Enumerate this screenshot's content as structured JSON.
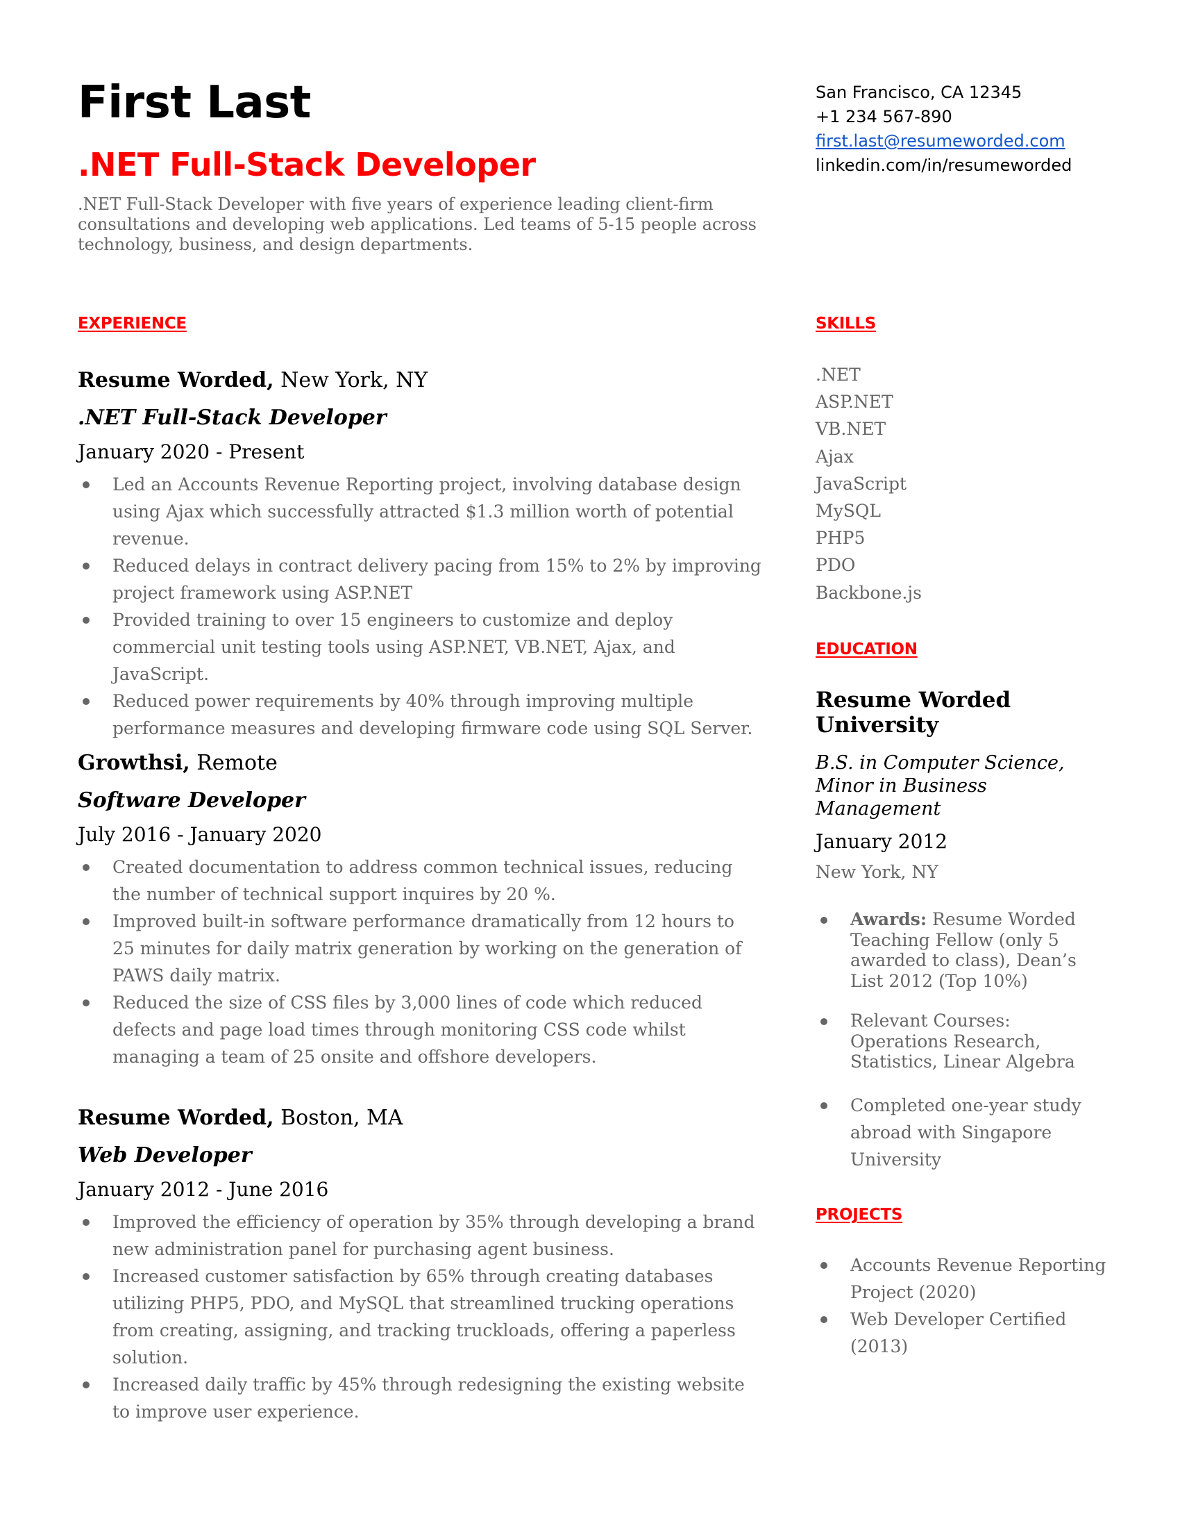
{
  "header": {
    "name": "First Last",
    "role": ".NET Full-Stack Developer",
    "summary": ".NET Full-Stack Developer with five years of experience leading client-firm consultations and developing web applications. Led teams of 5-15 people across technology, business, and design departments."
  },
  "contact": {
    "location": "San Francisco, CA 12345",
    "phone": "+1 234 567-890",
    "email": "first.last@resumeworded.com",
    "linkedin": "linkedin.com/in/resumeworded"
  },
  "colors": {
    "accent": "#ff0000",
    "body_text": "#666666",
    "link": "#1155cc"
  },
  "experience": {
    "heading": "EXPERIENCE",
    "jobs": [
      {
        "company": "Resume Worded,",
        "location": " New York, NY",
        "title": ".NET Full-Stack Developer",
        "dates": "January 2020 - Present",
        "bullets": [
          "Led an Accounts Revenue Reporting project, involving database design using Ajax which successfully attracted $1.3 million worth of potential revenue.",
          "Reduced delays in contract delivery pacing from 15% to 2% by improving project framework using ASP.NET",
          "Provided training to over 15 engineers to customize and deploy commercial unit testing tools using ASP.NET, VB.NET, Ajax, and JavaScript.",
          "Reduced power requirements by 40% through improving multiple performance measures and developing firmware code using SQL Server."
        ]
      },
      {
        "company": "Growthsi,",
        "location": " Remote",
        "title": "Software Developer",
        "dates": "July 2016 - January 2020",
        "bullets": [
          "Created documentation to address common technical issues, reducing the number of technical support inquires by 20 %.",
          "Improved built-in software performance dramatically from 12 hours to 25 minutes for daily matrix generation by working on the generation of PAWS daily matrix.",
          "Reduced the size of CSS files by 3,000 lines of code which reduced defects and page load times through monitoring CSS code whilst managing a  team of 25 onsite and offshore developers."
        ]
      },
      {
        "company": "Resume Worded,",
        "location": " Boston, MA",
        "title": "Web Developer",
        "dates": "January 2012 - June 2016",
        "bullets": [
          "Improved the efficiency of operation by 35% through developing a brand new administration panel for purchasing agent business.",
          "Increased customer satisfaction by 65% through creating databases utilizing PHP5, PDO, and MySQL that streamlined trucking operations from creating, assigning, and tracking truckloads, offering a paperless solution.",
          "Increased daily traffic by 45% through redesigning the existing website to improve user experience."
        ]
      }
    ]
  },
  "skills": {
    "heading": "SKILLS",
    "items": [
      ".NET",
      "ASP.NET",
      "VB.NET",
      "Ajax",
      "JavaScript",
      "MySQL",
      "PHP5",
      "PDO",
      "Backbone.js"
    ]
  },
  "education": {
    "heading": "EDUCATION",
    "school": "Resume Worded University",
    "degree": "B.S. in Computer Science, Minor in Business Management",
    "date": "January 2012",
    "location": "New York, NY",
    "bullets": [
      {
        "label": "Awards:",
        "text": " Resume Worded Teaching Fellow (only 5 awarded to class), Dean’s List 2012 (Top 10%)"
      },
      {
        "label": "",
        "text": "Relevant Courses: Operations Research, Statistics, Linear Algebra"
      },
      {
        "label": "",
        "text": "Completed one-year study abroad with Singapore University"
      }
    ]
  },
  "projects": {
    "heading": "PROJECTS",
    "items": [
      "Accounts Revenue Reporting Project (2020)",
      "Web Developer Certified (2013)"
    ]
  }
}
